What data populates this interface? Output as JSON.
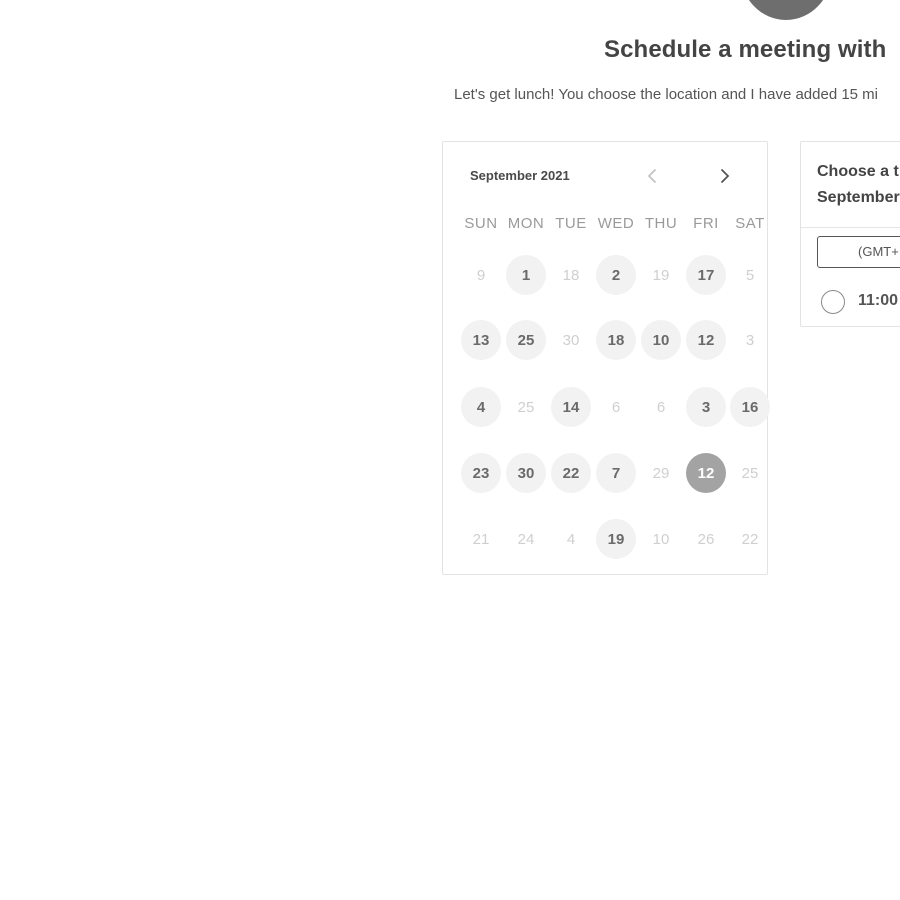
{
  "header": {
    "title": "Schedule a meeting with",
    "subtitle": "Let's get lunch! You choose the location and I have added 15 mi"
  },
  "calendar": {
    "month": "September 2021",
    "prev_icon": "chevron-left-icon",
    "next_icon": "chevron-right-icon",
    "weekdays": [
      "SUN",
      "MON",
      "TUE",
      "WED",
      "THU",
      "FRI",
      "SAT"
    ],
    "weeks": [
      [
        {
          "label": "9",
          "state": "unavailable"
        },
        {
          "label": "1",
          "state": "available"
        },
        {
          "label": "18",
          "state": "unavailable"
        },
        {
          "label": "2",
          "state": "available"
        },
        {
          "label": "19",
          "state": "unavailable"
        },
        {
          "label": "17",
          "state": "available"
        },
        {
          "label": "5",
          "state": "unavailable"
        }
      ],
      [
        {
          "label": "13",
          "state": "available"
        },
        {
          "label": "25",
          "state": "available"
        },
        {
          "label": "30",
          "state": "unavailable"
        },
        {
          "label": "18",
          "state": "available"
        },
        {
          "label": "10",
          "state": "available"
        },
        {
          "label": "12",
          "state": "available"
        },
        {
          "label": "3",
          "state": "unavailable"
        }
      ],
      [
        {
          "label": "4",
          "state": "available"
        },
        {
          "label": "25",
          "state": "unavailable"
        },
        {
          "label": "14",
          "state": "available"
        },
        {
          "label": "6",
          "state": "unavailable"
        },
        {
          "label": "6",
          "state": "unavailable"
        },
        {
          "label": "3",
          "state": "available"
        },
        {
          "label": "16",
          "state": "available"
        }
      ],
      [
        {
          "label": "23",
          "state": "available"
        },
        {
          "label": "30",
          "state": "available"
        },
        {
          "label": "22",
          "state": "available"
        },
        {
          "label": "7",
          "state": "available"
        },
        {
          "label": "29",
          "state": "unavailable"
        },
        {
          "label": "12",
          "state": "selected"
        },
        {
          "label": "25",
          "state": "unavailable"
        }
      ],
      [
        {
          "label": "21",
          "state": "unavailable"
        },
        {
          "label": "24",
          "state": "unavailable"
        },
        {
          "label": "4",
          "state": "unavailable"
        },
        {
          "label": "19",
          "state": "available"
        },
        {
          "label": "10",
          "state": "unavailable"
        },
        {
          "label": "26",
          "state": "unavailable"
        },
        {
          "label": "22",
          "state": "unavailable"
        }
      ]
    ]
  },
  "time_panel": {
    "heading_line1": "Choose a t",
    "heading_line2": "September",
    "timezone_value": "(GMT+",
    "slots": [
      {
        "label": "11:00"
      }
    ]
  },
  "colors": {
    "available_bg": "#f2f2f2",
    "selected_bg": "#a3a3a3",
    "avatar": "#6e6e6e"
  }
}
